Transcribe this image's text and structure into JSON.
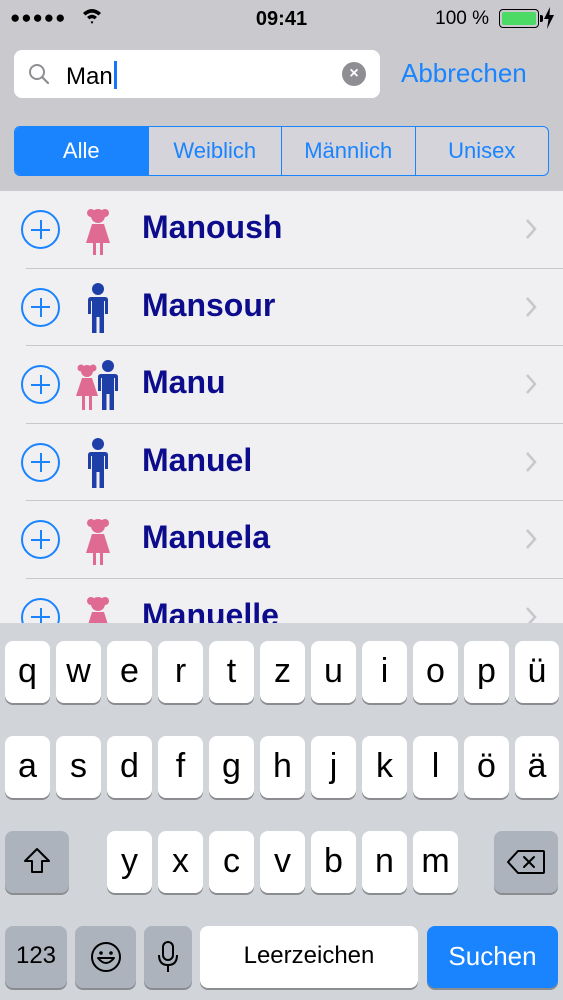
{
  "status_bar": {
    "signal": "●●●●●",
    "time": "09:41",
    "battery_text": "100 %"
  },
  "search": {
    "value": "Man",
    "cancel_label": "Abbrechen"
  },
  "segments": [
    {
      "label": "Alle",
      "active": true
    },
    {
      "label": "Weiblich",
      "active": false
    },
    {
      "label": "Männlich",
      "active": false
    },
    {
      "label": "Unisex",
      "active": false
    }
  ],
  "results": [
    {
      "name": "Manoush",
      "gender": "female"
    },
    {
      "name": "Mansour",
      "gender": "male"
    },
    {
      "name": "Manu",
      "gender": "unisex"
    },
    {
      "name": "Manuel",
      "gender": "male"
    },
    {
      "name": "Manuela",
      "gender": "female"
    },
    {
      "name": "Manuelle",
      "gender": "female"
    }
  ],
  "colors": {
    "accent": "#1a84ff",
    "name_text": "#0c0c8c",
    "female_icon": "#e06b92",
    "male_icon": "#1f3fa8"
  },
  "keyboard": {
    "row1": [
      "q",
      "w",
      "e",
      "r",
      "t",
      "z",
      "u",
      "i",
      "o",
      "p",
      "ü"
    ],
    "row2": [
      "a",
      "s",
      "d",
      "f",
      "g",
      "h",
      "j",
      "k",
      "l",
      "ö",
      "ä"
    ],
    "row3": [
      "y",
      "x",
      "c",
      "v",
      "b",
      "n",
      "m"
    ],
    "numbers_label": "123",
    "space_label": "Leerzeichen",
    "search_label": "Suchen"
  }
}
